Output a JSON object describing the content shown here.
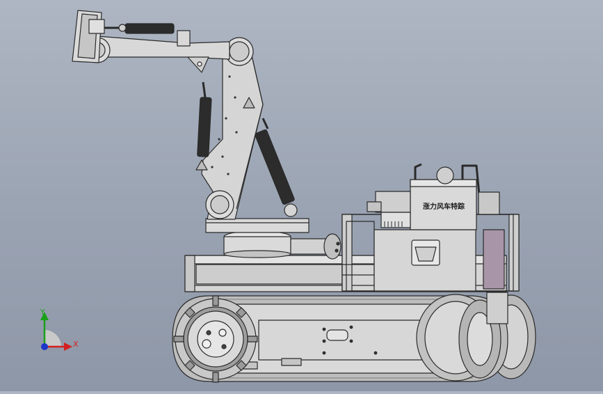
{
  "viewport": {
    "background_top": "#aeb6c3",
    "background_bottom": "#8e97a7"
  },
  "model": {
    "hydraulic_tank_label": "涨力风车特踪",
    "metal_color": "#d8d8d8",
    "edge_color": "#2a2a2a",
    "shadow_color": "#a9a9a9"
  },
  "triad": {
    "x_label": "X",
    "y_label": "Y",
    "x_color": "#d42020",
    "y_color": "#18a018",
    "z_color": "#1d38c8"
  }
}
